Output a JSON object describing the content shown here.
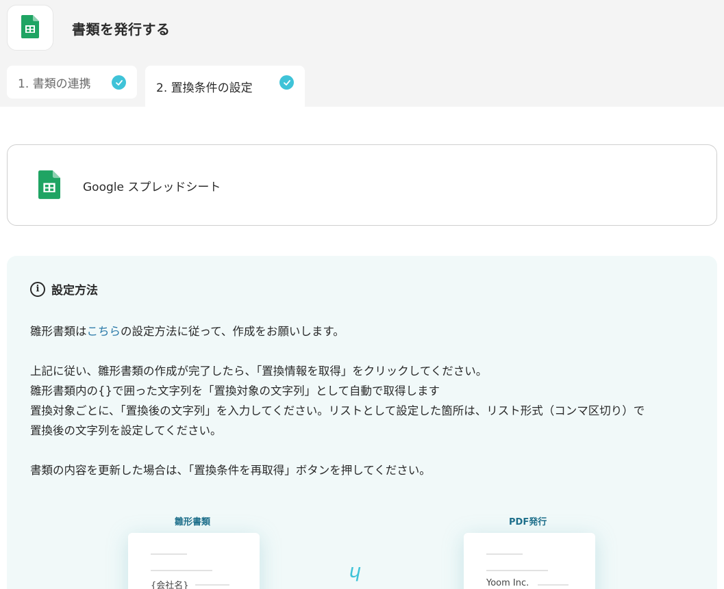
{
  "header": {
    "title": "書類を発行する",
    "app_icon": "google-sheets-icon"
  },
  "tabs": [
    {
      "label": "1. 書類の連携",
      "completed": true
    },
    {
      "label": "2. 置換条件の設定",
      "completed": true,
      "active": true
    }
  ],
  "app_card": {
    "name": "Google スプレッドシート",
    "icon": "google-sheets-icon"
  },
  "info": {
    "title": "設定方法",
    "line1_prefix": "雛形書類は",
    "line1_link": "こちら",
    "line1_suffix": "の設定方法に従って、作成をお願いします。",
    "line2": "上記に従い、雛形書類の作成が完了したら、「置換情報を取得」をクリックしてください。",
    "line3": "雛形書類内の{}で囲った文字列を「置換対象の文字列」として自動で取得します",
    "line4": "置換対象ごとに、「置換後の文字列」を入力してください。リストとして設定した箇所は、リスト形式（コンマ区切り）で",
    "line5": "置換後の文字列を設定してください。",
    "line6": "書類の内容を更新した場合は、「置換条件を再取得」ボタンを押してください。"
  },
  "diagram": {
    "left_label": "雛形書類",
    "left_doc_text": "{会社名}",
    "right_label": "PDF発行",
    "right_doc_text": "Yoom Inc."
  },
  "colors": {
    "accent": "#3fc3d8",
    "sheets_green": "#1fa463",
    "link": "#2a79a8"
  }
}
